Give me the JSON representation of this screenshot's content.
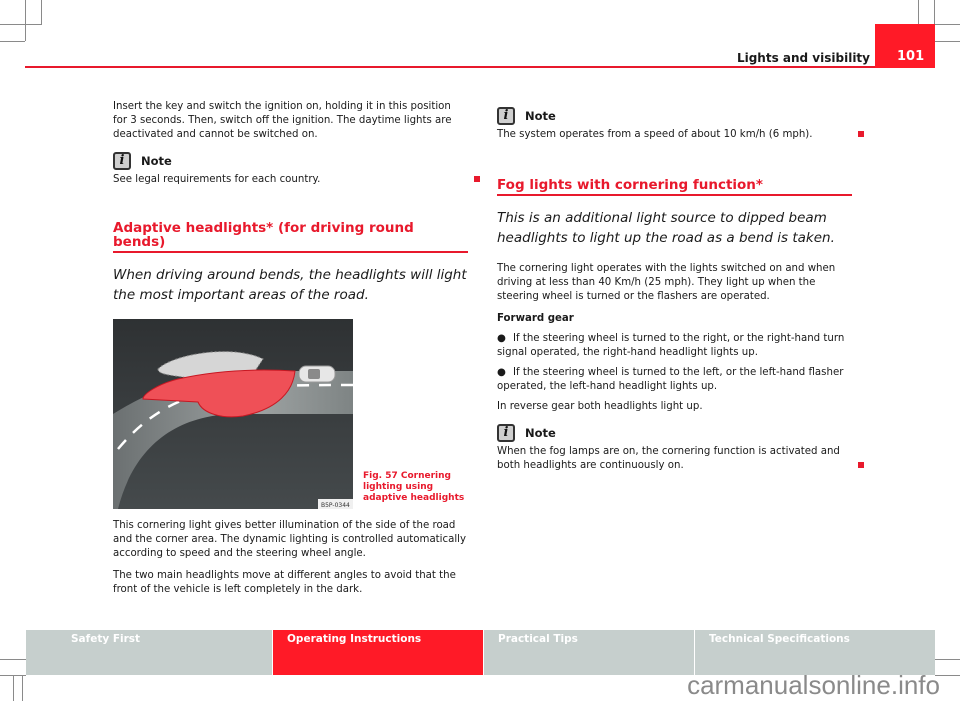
{
  "header": {
    "running_head": "Lights and visibility",
    "page_number": "101"
  },
  "left_column": {
    "para1": "Insert the key and switch the ignition on, holding it in this position for 3 seconds. Then, switch off the ignition. The daytime lights are deactivated and cannot be switched on.",
    "note1": {
      "label": "Note",
      "text": "See legal requirements for each country."
    },
    "section_title": "Adaptive headlights* (for driving round bends)",
    "intro": "When driving around bends, the headlights will light the most important areas of the road.",
    "figure": {
      "code": "B5P-0344",
      "caption": "Fig. 57   Cornering lighting using adaptive headlights"
    },
    "para2": "This cornering light gives better illumination of the side of the road and the corner area. The dynamic lighting is controlled automatically according to speed and the steering wheel angle.",
    "para3": "The two main headlights move at different angles to avoid that the front of the vehicle is left completely in the dark."
  },
  "right_column": {
    "note1": {
      "label": "Note",
      "text": "The system operates from a speed of about 10 km/h (6 mph)."
    },
    "section_title": "Fog lights with cornering function*",
    "intro": "This is an additional light source to dipped beam headlights to light up the road as a bend is taken.",
    "para1": "The cornering light operates with the lights switched on and when driving at less than 40 Km/h (25 mph). They light up when the steering wheel is turned or the flashers are operated.",
    "subhead": "Forward gear",
    "bullets": [
      "If the steering wheel is turned to the right, or the right-hand turn signal operated, the right-hand headlight lights up.",
      "If the steering wheel is turned to the left, or the left-hand flasher operated, the left-hand headlight lights up."
    ],
    "para2": "In reverse gear both headlights light up.",
    "note2": {
      "label": "Note",
      "text": "When the fog lamps are on, the cornering function is activated and both headlights are continuously on."
    }
  },
  "footer": {
    "tabs": [
      {
        "label": "Safety First",
        "active": false
      },
      {
        "label": "Operating Instructions",
        "active": true
      },
      {
        "label": "Practical Tips",
        "active": false
      },
      {
        "label": "Technical Specifications",
        "active": false
      }
    ]
  },
  "watermark": "carmanualsonline.info",
  "colors": {
    "accent": "#ff1a27",
    "tab_inactive": "#c6cfcd"
  }
}
